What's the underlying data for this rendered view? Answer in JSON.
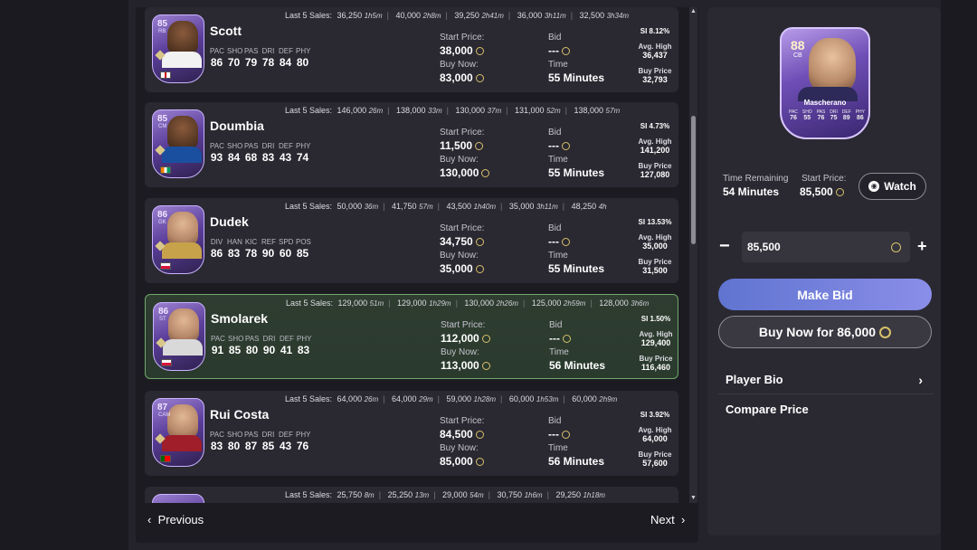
{
  "players": [
    {
      "name": "Scott",
      "rating": "85",
      "position": "RB",
      "sales": [
        [
          "36,250",
          "1h5m"
        ],
        [
          "40,000",
          "2h8m"
        ],
        [
          "39,250",
          "2h41m"
        ],
        [
          "36,000",
          "3h11m"
        ],
        [
          "32,500",
          "3h34m"
        ]
      ],
      "stats": [
        [
          "PAC",
          "86"
        ],
        [
          "SHO",
          "70"
        ],
        [
          "PAS",
          "79"
        ],
        [
          "DRI",
          "78"
        ],
        [
          "DEF",
          "84"
        ],
        [
          "PHY",
          "80"
        ]
      ],
      "start_price": "38,000",
      "buy_now": "83,000",
      "bid": "---",
      "time": "55 Minutes",
      "si": "SI 8.12%",
      "avg_high": "36,437",
      "buy_price": "32,793"
    },
    {
      "name": "Doumbia",
      "rating": "85",
      "position": "CM",
      "sales": [
        [
          "146,000",
          "26m"
        ],
        [
          "138,000",
          "33m"
        ],
        [
          "130,000",
          "37m"
        ],
        [
          "131,000",
          "52m"
        ],
        [
          "138,000",
          "57m"
        ]
      ],
      "stats": [
        [
          "PAC",
          "93"
        ],
        [
          "SHO",
          "84"
        ],
        [
          "PAS",
          "68"
        ],
        [
          "DRI",
          "83"
        ],
        [
          "DEF",
          "43"
        ],
        [
          "PHY",
          "74"
        ]
      ],
      "start_price": "11,500",
      "buy_now": "130,000",
      "bid": "---",
      "time": "55 Minutes",
      "si": "SI 4.73%",
      "avg_high": "141,200",
      "buy_price": "127,080"
    },
    {
      "name": "Dudek",
      "rating": "86",
      "position": "GK",
      "sales": [
        [
          "50,000",
          "36m"
        ],
        [
          "41,750",
          "57m"
        ],
        [
          "43,500",
          "1h40m"
        ],
        [
          "35,000",
          "3h11m"
        ],
        [
          "48,250",
          "4h"
        ]
      ],
      "stats": [
        [
          "DIV",
          "86"
        ],
        [
          "HAN",
          "83"
        ],
        [
          "KIC",
          "78"
        ],
        [
          "REF",
          "90"
        ],
        [
          "SPD",
          "60"
        ],
        [
          "POS",
          "85"
        ]
      ],
      "start_price": "34,750",
      "buy_now": "35,000",
      "bid": "---",
      "time": "55 Minutes",
      "si": "SI 13.53%",
      "avg_high": "35,000",
      "buy_price": "31,500"
    },
    {
      "name": "Smolarek",
      "rating": "86",
      "position": "ST",
      "sales": [
        [
          "129,000",
          "51m"
        ],
        [
          "129,000",
          "1h29m"
        ],
        [
          "130,000",
          "2h26m"
        ],
        [
          "125,000",
          "2h59m"
        ],
        [
          "128,000",
          "3h6m"
        ]
      ],
      "stats": [
        [
          "PAC",
          "91"
        ],
        [
          "SHO",
          "85"
        ],
        [
          "PAS",
          "80"
        ],
        [
          "DRI",
          "90"
        ],
        [
          "DEF",
          "41"
        ],
        [
          "PHY",
          "83"
        ]
      ],
      "start_price": "112,000",
      "buy_now": "113,000",
      "bid": "---",
      "time": "56 Minutes",
      "si": "SI 1.50%",
      "avg_high": "129,400",
      "buy_price": "116,460"
    },
    {
      "name": "Rui Costa",
      "rating": "87",
      "position": "CAM",
      "sales": [
        [
          "64,000",
          "26m"
        ],
        [
          "64,000",
          "29m"
        ],
        [
          "59,000",
          "1h28m"
        ],
        [
          "60,000",
          "1h53m"
        ],
        [
          "60,000",
          "2h9m"
        ]
      ],
      "stats": [
        [
          "PAC",
          "83"
        ],
        [
          "SHO",
          "80"
        ],
        [
          "PAS",
          "87"
        ],
        [
          "DRI",
          "85"
        ],
        [
          "DEF",
          "43"
        ],
        [
          "PHY",
          "76"
        ]
      ],
      "start_price": "84,500",
      "buy_now": "85,000",
      "bid": "---",
      "time": "56 Minutes",
      "si": "SI 3.92%",
      "avg_high": "64,000",
      "buy_price": "57,600"
    },
    {
      "sales": [
        [
          "25,750",
          "8m"
        ],
        [
          "25,250",
          "13m"
        ],
        [
          "29,000",
          "54m"
        ],
        [
          "30,750",
          "1h6m"
        ],
        [
          "29,250",
          "1h18m"
        ]
      ]
    }
  ],
  "labels": {
    "last5": "Last 5 Sales:",
    "start_price": "Start Price:",
    "buy_now": "Buy Now:",
    "bid": "Bid",
    "time": "Time",
    "avg_high": "Avg. High",
    "buy_price": "Buy Price"
  },
  "nav": {
    "previous": "Previous",
    "next": "Next"
  },
  "detail": {
    "player_name": "Mascherano",
    "rating": "88",
    "position": "CB",
    "card_stats": [
      [
        "PAC",
        "76"
      ],
      [
        "SHO",
        "55"
      ],
      [
        "PAS",
        "76"
      ],
      [
        "DRI",
        "75"
      ],
      [
        "DEF",
        "89"
      ],
      [
        "PHY",
        "86"
      ]
    ],
    "time_remaining_label": "Time Remaining",
    "time_remaining": "54 Minutes",
    "start_price_label": "Start Price:",
    "start_price": "85,500",
    "watch": "Watch",
    "bid_value": "85,500",
    "make_bid": "Make Bid",
    "buy_now": "Buy Now for 86,000",
    "player_bio": "Player Bio",
    "compare_price": "Compare Price"
  },
  "colors": {
    "accent": "#7a86e0",
    "coin": "#d8c06a",
    "selected_border": "#6fa86a"
  }
}
